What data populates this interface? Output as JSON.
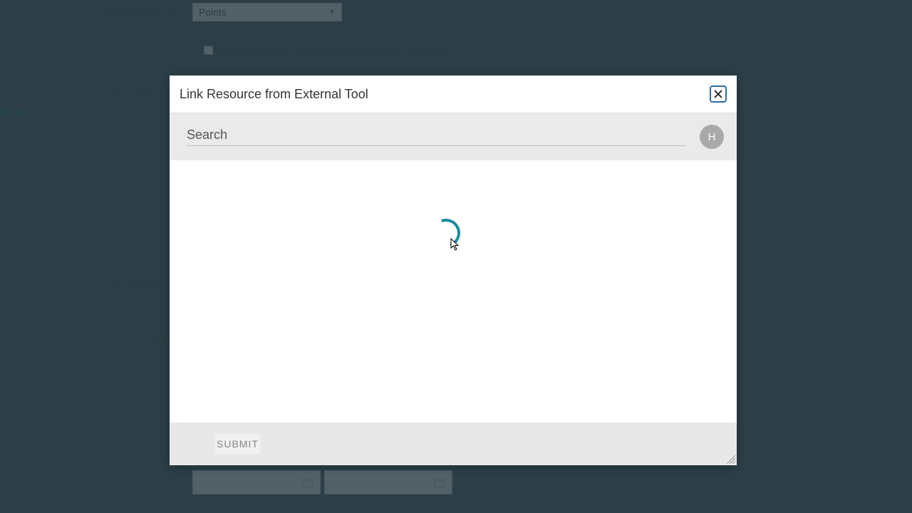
{
  "bg": {
    "display_grade_label": "Display Grade as",
    "display_grade_value": "Points",
    "final_grade_checkbox_label": "Do not count this assignment towards the final grade",
    "submission_label": "Submission T",
    "link_fragment": "ks.net",
    "sync_label": "Sync to Powersch",
    "assign_label": "Ass"
  },
  "modal": {
    "title": "Link Resource from External Tool",
    "search_label": "Search",
    "avatar_letter": "H",
    "submit_label": "SUBMIT"
  }
}
